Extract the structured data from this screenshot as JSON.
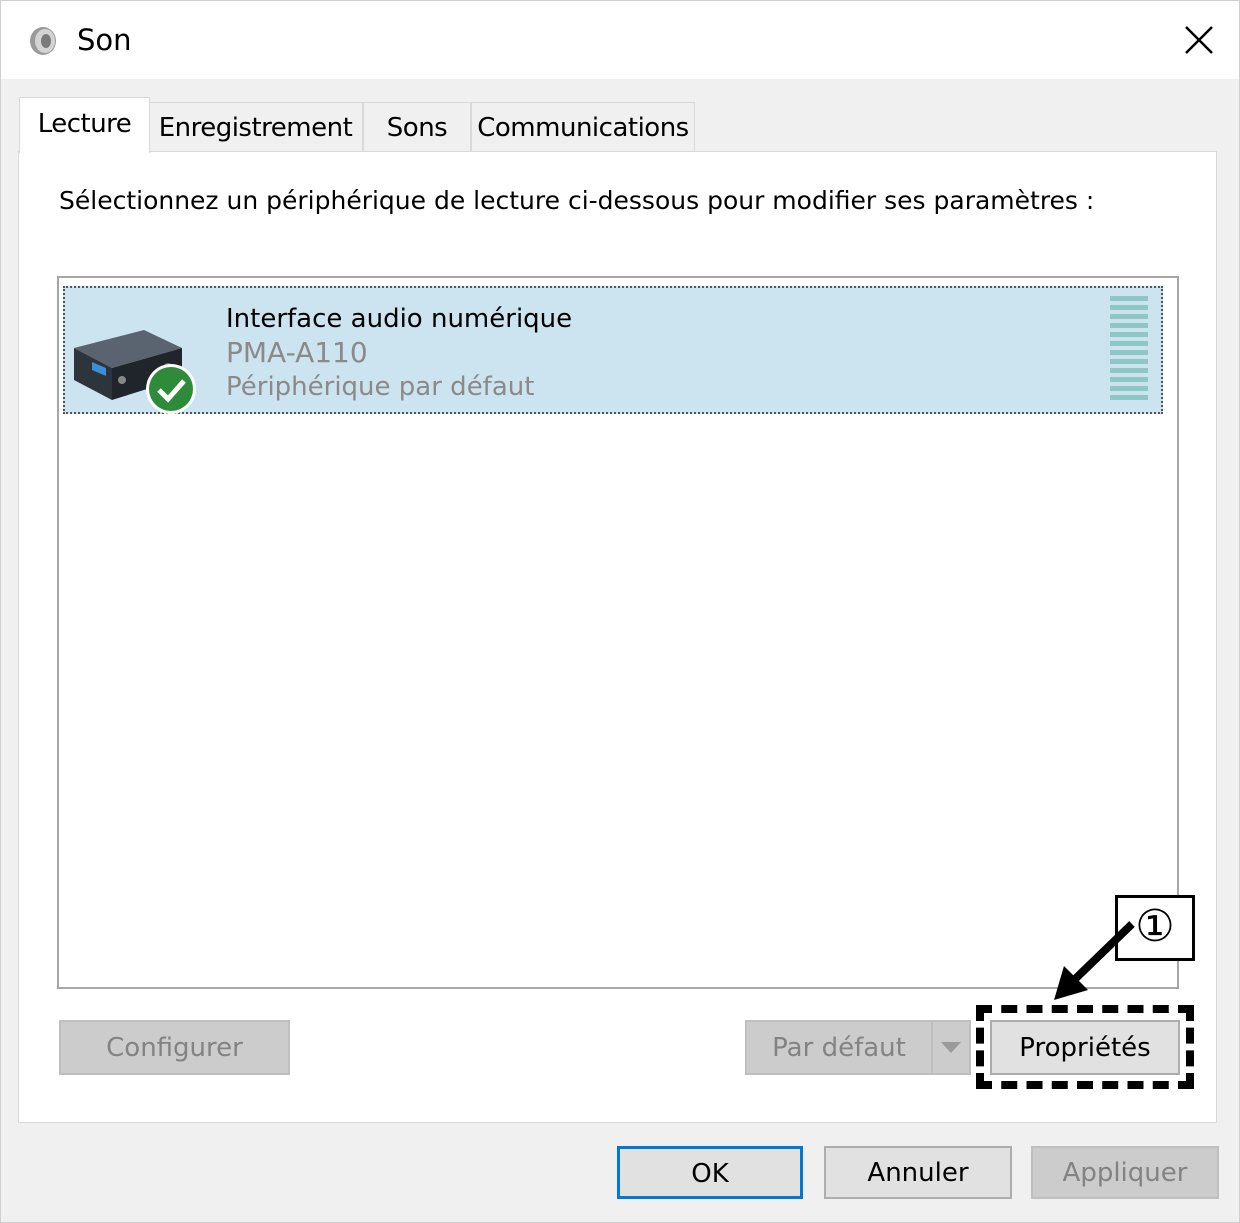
{
  "window": {
    "title": "Son",
    "app_icon": "speaker-icon",
    "close_icon": "close-icon"
  },
  "tabs": [
    {
      "label": "Lecture",
      "active": true
    },
    {
      "label": "Enregistrement",
      "active": false
    },
    {
      "label": "Sons",
      "active": false
    },
    {
      "label": "Communications",
      "active": false
    }
  ],
  "panel": {
    "instruction": "Sélectionnez un périphérique de lecture ci-dessous pour modifier ses paramètres :"
  },
  "devices": [
    {
      "name": "Interface audio numérique",
      "model": "PMA-A110",
      "status": "Périphérique par défaut",
      "icon": "audio-device-icon",
      "badge_icon": "default-check-icon"
    }
  ],
  "buttons": {
    "configure": "Configurer",
    "set_default": "Par défaut",
    "properties": "Propriétés",
    "ok": "OK",
    "cancel": "Annuler",
    "apply": "Appliquer"
  },
  "annotation": {
    "step": "①"
  },
  "colors": {
    "selection": "#cce4ef",
    "accent": "#0078d7",
    "check": "#2e8b3a"
  }
}
